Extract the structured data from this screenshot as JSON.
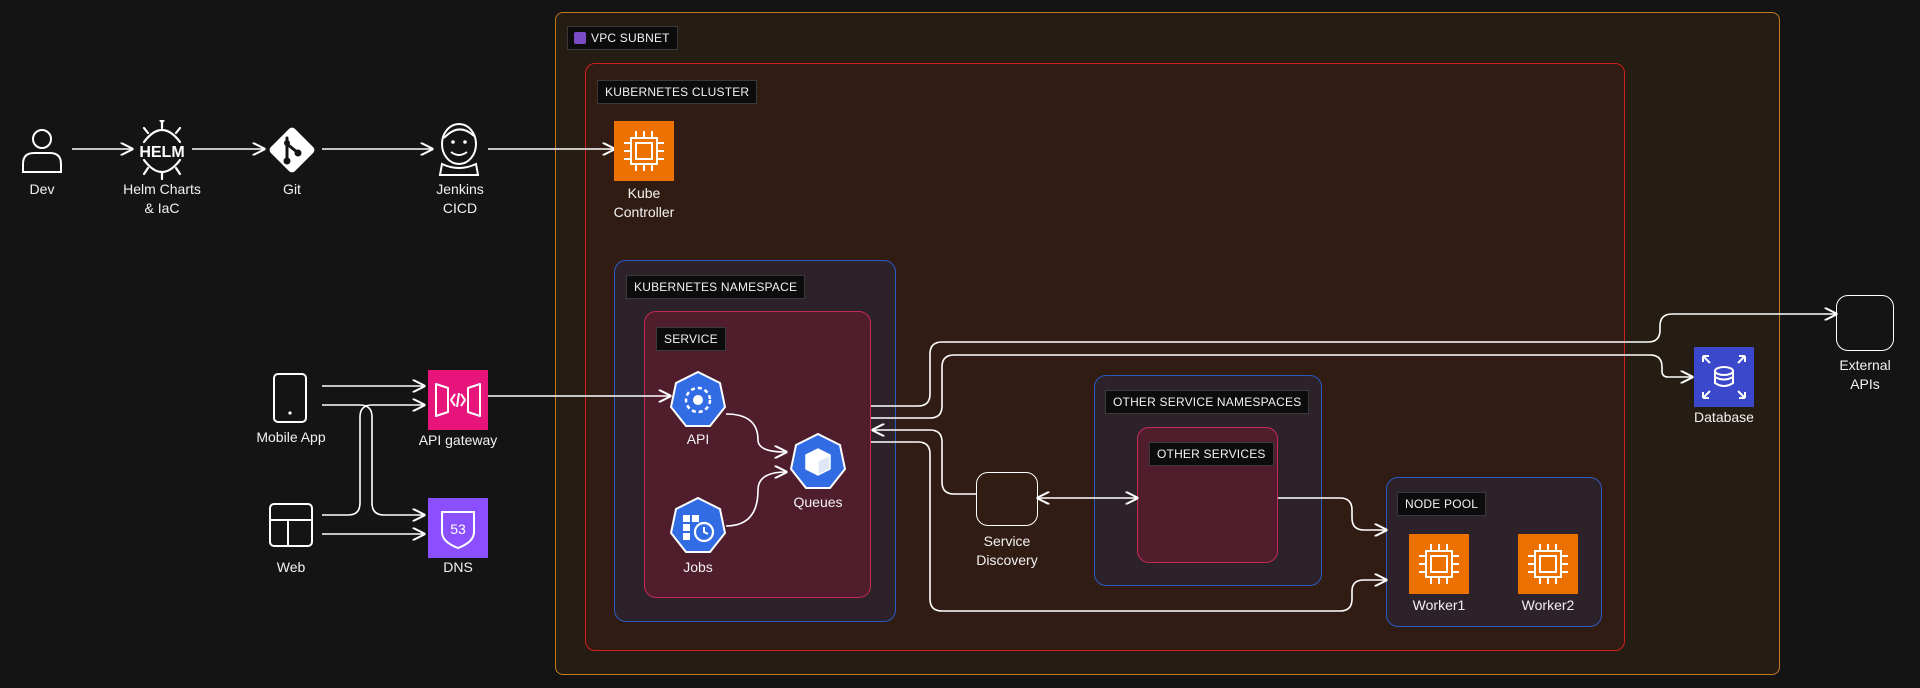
{
  "containers": {
    "vpc": "VPC SUBNET",
    "cluster": "KUBERNETES CLUSTER",
    "namespace": "KUBERNETES NAMESPACE",
    "service": "SERVICE",
    "other_namespaces": "OTHER SERVICE NAMESPACES",
    "other_services": "OTHER SERVICES",
    "node_pool": "NODE POOL"
  },
  "nodes": {
    "dev": "Dev",
    "helm_logo": "HELM",
    "helm": "Helm Charts\n& IaC",
    "git": "Git",
    "jenkins": "Jenkins\nCICD",
    "kube_controller": "Kube\nController",
    "mobile_app": "Mobile App",
    "web": "Web",
    "api_gateway": "API gateway",
    "dns": "DNS",
    "dns_badge": "53",
    "api": "API",
    "jobs": "Jobs",
    "queues": "Queues",
    "service_discovery": "Service\nDiscovery",
    "worker1": "Worker1",
    "worker2": "Worker2",
    "database": "Database",
    "external_apis": "External\nAPIs"
  },
  "colors": {
    "background": "#141414",
    "vpc_border": "#c47a1c",
    "cluster_border": "#d01e1e",
    "namespace_border": "#2a5bc4",
    "service_border": "#c42a55",
    "aws_compute": "#ed7100",
    "aws_network": "#e7157b",
    "aws_dns": "#8c4fff",
    "aws_database": "#3b48cc",
    "k8s_blue": "#326ce5"
  }
}
